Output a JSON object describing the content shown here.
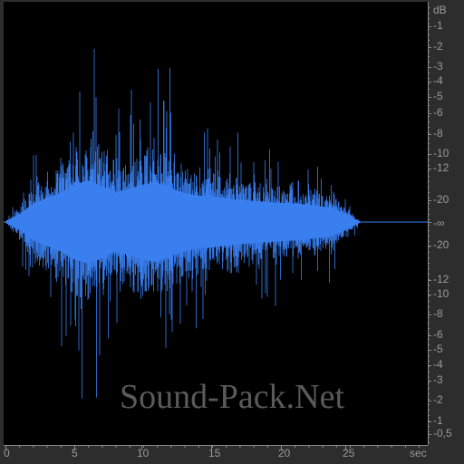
{
  "watermark": "Sound-Pack.Net",
  "colors": {
    "waveform": "#3a7fef",
    "background": "#000000",
    "axis_text": "#9a9a9a",
    "frame": "#2d2d2d"
  },
  "db_scale": {
    "unit": "dB",
    "upper": [
      "-1",
      "-2",
      "-3",
      "-4",
      "-5",
      "-6",
      "-8",
      "-10",
      "-12",
      "-20"
    ],
    "center": "-∞",
    "lower": [
      "-20",
      "-12",
      "-10",
      "-8",
      "-6",
      "-5",
      "-4",
      "-3",
      "-2",
      "-1",
      "-0,5"
    ]
  },
  "time_scale": {
    "unit": "sec",
    "ticks": [
      "0",
      "5",
      "10",
      "15",
      "20",
      "25"
    ]
  },
  "chart_data": {
    "type": "area",
    "x": [
      0,
      1,
      2,
      3,
      4,
      5,
      6,
      7,
      8,
      9,
      10,
      11,
      12,
      13,
      14,
      15,
      16,
      17,
      18,
      19,
      20,
      21,
      22,
      23,
      24,
      25,
      26,
      27
    ],
    "series": [
      {
        "values": [
          0.02,
          0.15,
          0.35,
          0.45,
          0.55,
          0.7,
          0.78,
          0.68,
          0.55,
          0.62,
          0.7,
          0.75,
          0.65,
          0.55,
          0.5,
          0.48,
          0.45,
          0.42,
          0.4,
          0.38,
          0.36,
          0.35,
          0.33,
          0.3,
          0.26,
          0.14,
          0.01,
          0.0
        ]
      }
    ],
    "xlim": [
      0,
      27
    ],
    "xlabel": "sec",
    "ylabel": "dB"
  }
}
